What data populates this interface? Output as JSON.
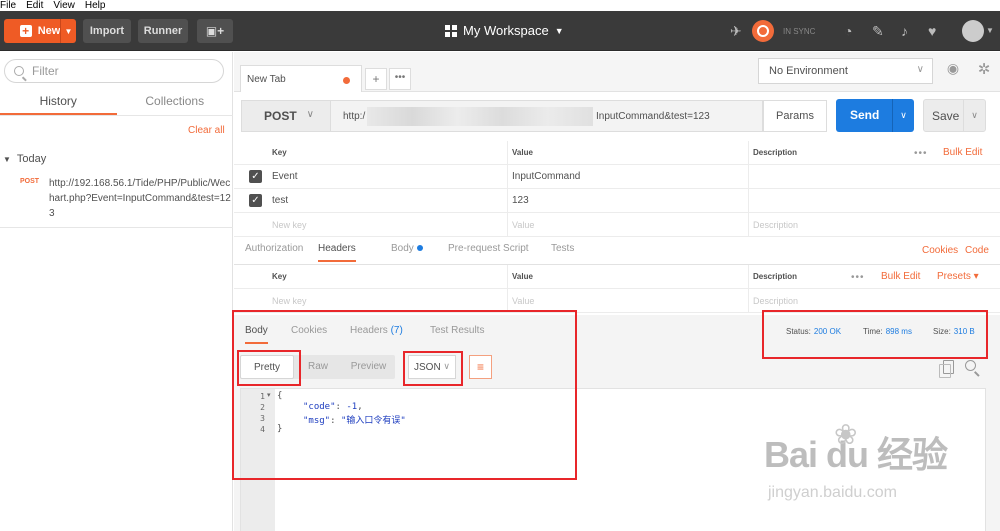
{
  "menu": [
    "File",
    "Edit",
    "View",
    "Help"
  ],
  "topbar": {
    "new_label": "New",
    "import_label": "Import",
    "runner_label": "Runner",
    "workspace_label": "My Workspace",
    "sync_label": "IN SYNC"
  },
  "sidebar": {
    "filter_placeholder": "Filter",
    "tabs": [
      "History",
      "Collections"
    ],
    "clear_all": "Clear all",
    "group_label": "Today",
    "history": [
      {
        "method": "POST",
        "url": "http://192.168.56.1/Tide/PHP/Public/Wechart.php?Event=InputCommand&test=123"
      }
    ]
  },
  "tabs": {
    "current": "New Tab",
    "add": "+",
    "more": "•••"
  },
  "environment": {
    "selected": "No Environment"
  },
  "request": {
    "method": "POST",
    "url_prefix": "http:/",
    "url_suffix": "InputCommand&test=123",
    "params_label": "Params",
    "send_label": "Send",
    "save_label": "Save"
  },
  "params_table": {
    "headers": [
      "Key",
      "Value",
      "Description"
    ],
    "bulk_edit": "Bulk Edit",
    "rows": [
      {
        "key": "Event",
        "value": "InputCommand"
      },
      {
        "key": "test",
        "value": "123"
      }
    ],
    "placeholder": {
      "key": "New key",
      "value": "Value",
      "description": "Description"
    }
  },
  "request_subtabs": {
    "tabs": [
      "Authorization",
      "Headers",
      "Body",
      "Pre-request Script",
      "Tests"
    ],
    "cookies": "Cookies",
    "code": "Code"
  },
  "headers_table": {
    "headers": [
      "Key",
      "Value",
      "Description"
    ],
    "bulk_edit": "Bulk Edit",
    "presets": "Presets ▾",
    "placeholder": {
      "key": "New key",
      "value": "Value",
      "description": "Description"
    }
  },
  "response": {
    "tabs": [
      "Body",
      "Cookies",
      "Headers",
      "Test Results"
    ],
    "headers_count": "(7)",
    "status_label": "Status:",
    "status_value": "200 OK",
    "time_label": "Time:",
    "time_value": "898 ms",
    "size_label": "Size:",
    "size_value": "310 B",
    "formats": [
      "Pretty",
      "Raw",
      "Preview"
    ],
    "language": "JSON",
    "code_lines": [
      "1",
      "2",
      "3",
      "4"
    ],
    "json": {
      "open": "{",
      "code_key": "\"code\"",
      "code_value": "-1",
      "msg_key": "\"msg\"",
      "msg_value": "\"输入口令有误\"",
      "close": "}"
    }
  },
  "watermark": {
    "logo": "Bai  du 经验",
    "url": "jingyan.baidu.com"
  },
  "colors": {
    "accent": "#f26b3a",
    "send": "#1d7ce0",
    "annotation": "#e8262a",
    "topbar": "#3a3a3a"
  }
}
